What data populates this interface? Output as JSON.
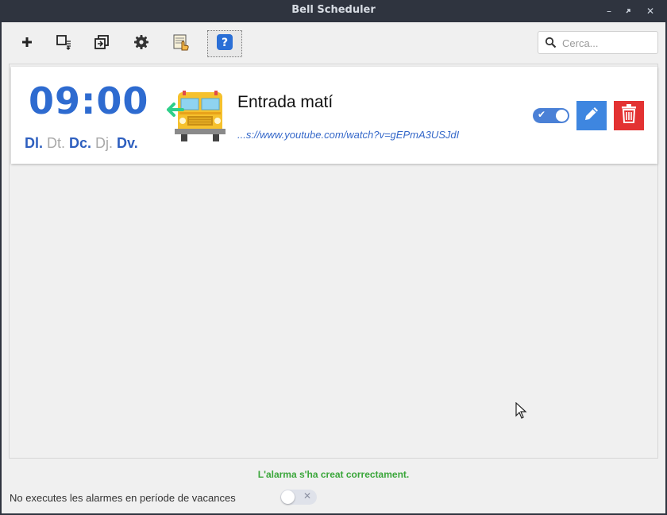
{
  "window": {
    "title": "Bell Scheduler",
    "controls": [
      "minimize",
      "maximize",
      "close"
    ]
  },
  "toolbar": {
    "icons": [
      "add-icon",
      "export-icon",
      "import-icon",
      "gear-icon",
      "holidays-icon",
      "help-icon"
    ],
    "search_placeholder": "Cerca..."
  },
  "alarm": {
    "time": "09:00",
    "days": [
      {
        "label": "Dl.",
        "active": true
      },
      {
        "label": "Dt.",
        "active": false
      },
      {
        "label": "Dc.",
        "active": true
      },
      {
        "label": "Dj.",
        "active": false
      },
      {
        "label": "Dv.",
        "active": true
      }
    ],
    "title": "Entrada matí",
    "url": "...s://www.youtube.com/watch?v=gEPmA3USJdI",
    "enabled": true,
    "colors": {
      "time": "#2e6bd0",
      "edit": "#3e86e0",
      "delete": "#e33232"
    }
  },
  "footer": {
    "status": "L'alarma s'ha creat correctament.",
    "vacation_label": "No executes les alarmes en període de vacances",
    "vacation_enabled": false
  }
}
